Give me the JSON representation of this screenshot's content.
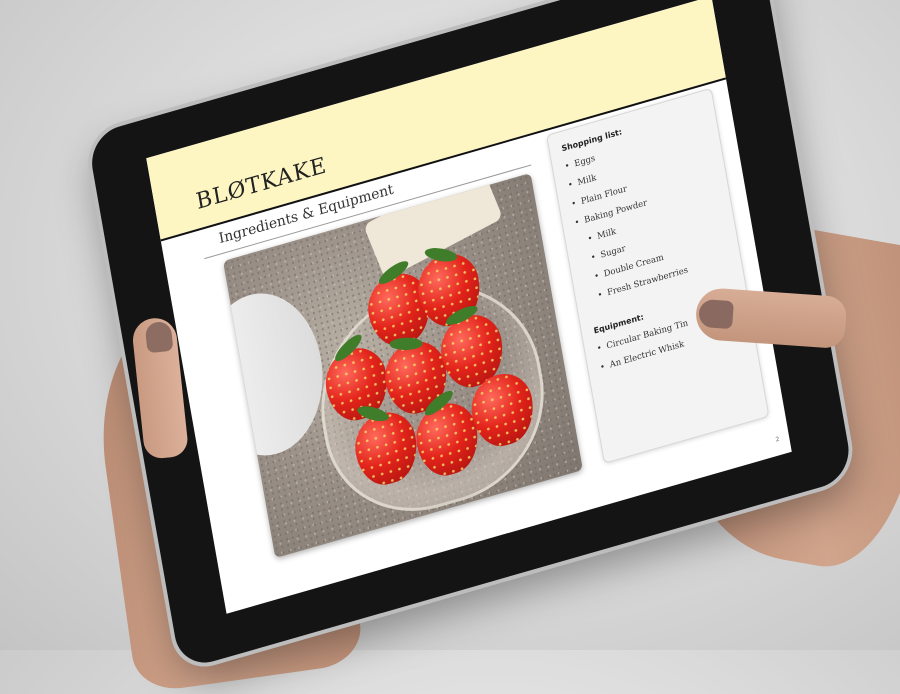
{
  "slide": {
    "title": "BLØTKAKE",
    "subtitle": "Ingredients & Equipment",
    "page_number": "2"
  },
  "shopping": {
    "heading": "Shopping list:",
    "items": [
      "Eggs",
      "Milk",
      "Plain Flour",
      "Baking Powder",
      "Milk",
      "Sugar",
      "Double Cream",
      "Fresh Strawberries"
    ]
  },
  "equipment": {
    "heading": "Equipment:",
    "items": [
      "Circular Baking Tin",
      "An Electric Whisk"
    ]
  },
  "colors": {
    "header_band": "#fdf6c3",
    "bezel": "#141414",
    "panel": "#f3f3f3"
  }
}
